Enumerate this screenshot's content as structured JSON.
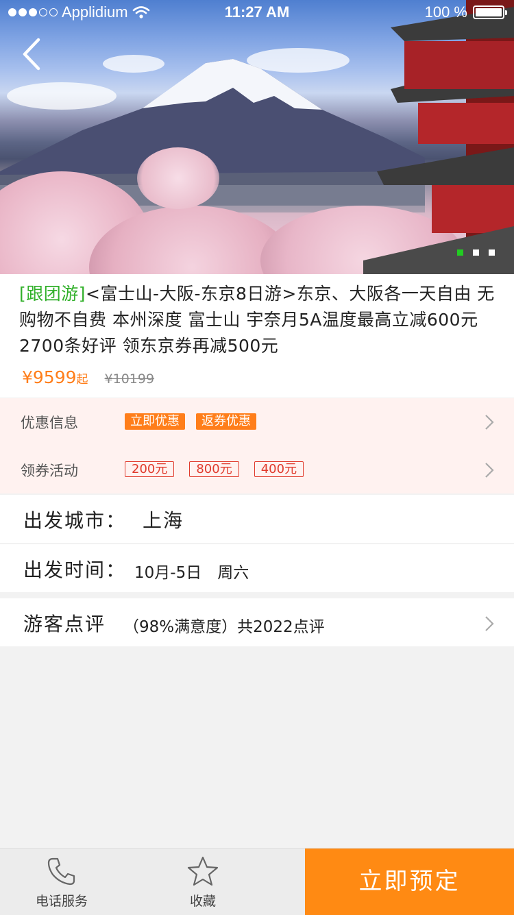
{
  "status_bar": {
    "carrier": "Applidium",
    "time": "11:27 AM",
    "battery": "100 %",
    "signal_dots_filled": 3,
    "signal_dots_total": 5
  },
  "hero": {
    "image_description_icon": "mount-fuji-photo",
    "pager_count": 3,
    "pager_active_index": 0
  },
  "product": {
    "tag": "[跟团游]",
    "title": "<富士山-大阪-东京8日游>东京、大阪各一天自由 无购物不自费 本州深度 富士山 宇奈月5A温度最高立减600元 2700条好评 领东京券再减500元",
    "price": "¥9599",
    "price_suffix": "起",
    "old_price": "¥10199"
  },
  "offers": {
    "discount_label": "优惠信息",
    "discount_chips": [
      "立即优惠",
      "返券优惠"
    ],
    "coupon_label": "领券活动",
    "coupon_chips": [
      "200元",
      "800元",
      "400元"
    ]
  },
  "departure_city": {
    "label": "出发城市：",
    "value": "上海"
  },
  "departure_time": {
    "label": "出发时间：",
    "value": "10月-5日　周六"
  },
  "reviews": {
    "label": "游客点评",
    "value": "（98%满意度）共2022点评"
  },
  "bottom_bar": {
    "phone_label": "电话服务",
    "favorite_label": "收藏",
    "book_label": "立即预定"
  },
  "colors": {
    "accent": "#ff8a13",
    "price": "#ff7e1a",
    "tag_green": "#31b02a",
    "coupon_red": "#e03a2c",
    "offers_bg": "#fff2f0"
  }
}
